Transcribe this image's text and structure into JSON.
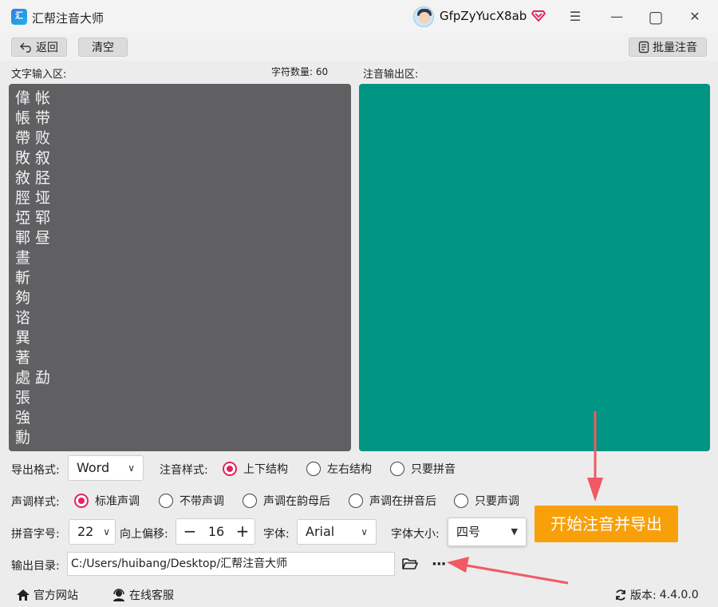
{
  "app": {
    "title": "汇帮注音大师",
    "logo_text": "汇"
  },
  "user": {
    "name": "GfpZyYucX8ab"
  },
  "window_controls": {
    "menu": "☰",
    "minimize": "—",
    "maximize": "▢",
    "close": "✕"
  },
  "toolbar": {
    "back_label": "返回",
    "clear_label": "清空",
    "batch_label": "批量注音"
  },
  "input_section": {
    "label": "文字输入区:",
    "char_count_label": "字符数量:",
    "char_count": "60"
  },
  "output_section": {
    "label": "注音输出区:"
  },
  "input_text": "偉 帐\n帳 带\n帶 败\n敗 叙\n敘 胫\n脛 垭\n埡 郓\n鄆 昼\n晝\n斬\n夠\n谘\n異\n著\n處 勐\n張\n強\n勳",
  "export_format": {
    "label": "导出格式:",
    "value": "Word"
  },
  "phonetic_style": {
    "label": "注音样式:",
    "options": [
      "上下结构",
      "左右结构",
      "只要拼音"
    ],
    "selected": "上下结构"
  },
  "tone_style": {
    "label": "声调样式:",
    "options": [
      "标准声调",
      "不带声调",
      "声调在韵母后",
      "声调在拼音后",
      "只要声调"
    ],
    "selected": "标准声调"
  },
  "pinyin_size": {
    "label": "拼音字号:",
    "value": "22"
  },
  "offset": {
    "label": "向上偏移:",
    "value": "16",
    "minus": "−",
    "plus": "+"
  },
  "font": {
    "label": "字体:",
    "value": "Arial"
  },
  "font_size": {
    "label": "字体大小:",
    "value": "四号"
  },
  "start_button": {
    "label": "开始注音并导出"
  },
  "output_dir": {
    "label": "输出目录:",
    "value": "C:/Users/huibang/Desktop/汇帮注音大师",
    "more": "···"
  },
  "statusbar": {
    "website": "官方网站",
    "support": "在线客服",
    "version_label": "版本:",
    "version": "4.4.0.0"
  },
  "colors": {
    "accent": "#f7a00a",
    "output_bg": "#009483",
    "input_bg": "#606063",
    "radio_on": "#e0245e",
    "arrow": "#f05a63"
  }
}
